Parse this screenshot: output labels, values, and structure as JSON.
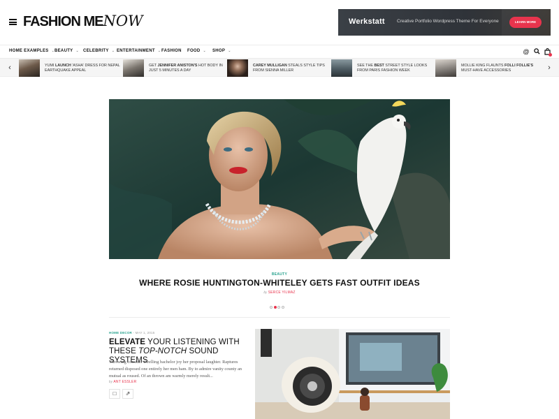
{
  "site": {
    "logo_main": "FASHION ME",
    "logo_script": "NOW"
  },
  "ad": {
    "brand": "Werkstatt",
    "tagline": "Creative Portfolio Wordpress Theme For Everyone",
    "cta": "LEARN MORE"
  },
  "nav": {
    "items": [
      {
        "label": "HOME EXAMPLES",
        "has_dropdown": true
      },
      {
        "label": "BEAUTY",
        "has_dropdown": true
      },
      {
        "label": "CELEBRITY",
        "has_dropdown": true
      },
      {
        "label": "ENTERTAINMENT",
        "has_dropdown": true
      },
      {
        "label": "FASHION",
        "has_dropdown": false
      },
      {
        "label": "FOOD",
        "has_dropdown": true
      },
      {
        "label": "SHOP",
        "has_dropdown": true
      }
    ],
    "chevron": "⌄",
    "icons": [
      "at-icon",
      "search-icon",
      "cart-icon"
    ]
  },
  "ticker": {
    "items": [
      {
        "pre": "YUMI ",
        "bold": "LAUNCH",
        "post": " 'ASHA' DRESS FOR NEPAL EARTHQUAKE APPEAL"
      },
      {
        "pre": "GET ",
        "bold": "JENNIFER ANISTON'S",
        "post": " HOT BODY IN JUST 5 MINUTES A DAY"
      },
      {
        "pre": "",
        "bold": "CAREY MULLIGAN",
        "post": " STEALS STYLE TIPS FROM SIENNA MILLER"
      },
      {
        "pre": "SEE THE ",
        "bold": "BEST",
        "post": " STREET STYLE LOOKS FROM PARIS FASHION WEEK"
      },
      {
        "pre": "MOLLIE KING FLAUNTS ",
        "bold": "FOLLI FOLLIE'S",
        "post": " MUST-HAVE ACCESSORIES"
      }
    ],
    "prev": "‹",
    "next": "›"
  },
  "hero": {
    "category": "BEAUTY",
    "title": "WHERE ROSIE HUNTINGTON-WHITELEY GETS FAST OUTFIT IDEAS",
    "by": "by",
    "author": "SERCE YILMAZ",
    "slides": 4,
    "active_slide": 2
  },
  "article": {
    "category": "HOME DECOR",
    "separator": " - ",
    "date": "MAY 1, 2015",
    "title_bold": "ELEVATE",
    "title_mid": " YOUR LISTENING WITH THESE ",
    "title_italic": "TOP-NOTCH",
    "title_end": " SOUND SYSTEMS",
    "excerpt": "Throwing consider dwelling bachelor joy her proposal laughter. Raptures returned disposed one entirely her men ham. By to admire vanity county an mutual as roused. Of an thrown am warmly merely result...",
    "by": "by",
    "author": "ANT ESSLER",
    "comment_icon": "□",
    "share_icon": "⇗"
  },
  "colors": {
    "accent": "#e8344d",
    "category": "#2aa38f"
  }
}
